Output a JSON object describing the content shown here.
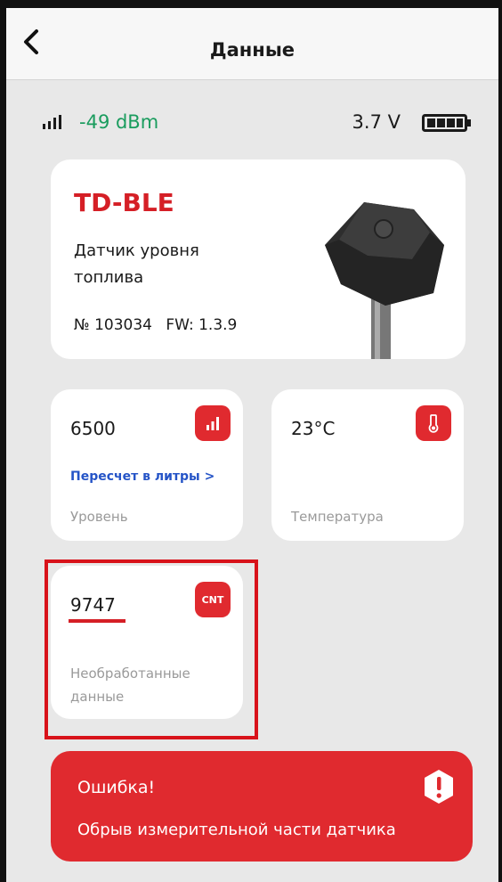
{
  "header": {
    "title": "Данные"
  },
  "status": {
    "rssi": "-49 dBm",
    "voltage": "3.7 V"
  },
  "device": {
    "name": "TD-BLE",
    "type": "Датчик уровня топлива",
    "serial": "№ 103034",
    "firmware": "FW: 1.3.9"
  },
  "tiles": {
    "level": {
      "value": "6500",
      "link": "Пересчет в литры >",
      "label": "Уровень"
    },
    "temperature": {
      "value": "23°C",
      "label": "Температура"
    },
    "raw": {
      "value": "9747",
      "badge": "CNT",
      "label": "Необработанные данные"
    }
  },
  "error": {
    "title": "Ошибка!",
    "message": "Обрыв измерительной части датчика"
  },
  "colors": {
    "accent": "#e02a2f",
    "signal": "#1a9c5e",
    "link": "#2554c7"
  }
}
